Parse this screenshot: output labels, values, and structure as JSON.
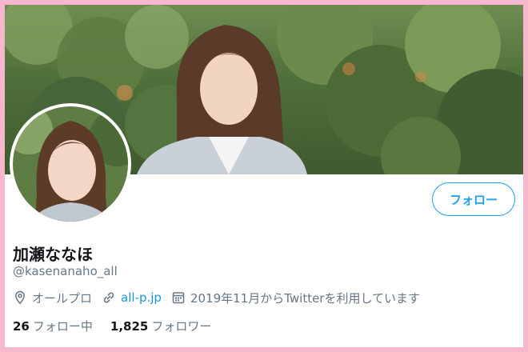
{
  "profile": {
    "display_name": "加瀬ななほ",
    "handle": "@kasenanaho_all",
    "location": "オールプロ",
    "website": "all-p.jp",
    "joined": "2019年11月からTwitterを利用しています",
    "follow_button": "フォロー"
  },
  "stats": {
    "following_count": "26",
    "following_label": "フォロー中",
    "followers_count": "1,825",
    "followers_label": "フォロワー"
  },
  "colors": {
    "accent": "#1da1f2",
    "link": "#1b95e0",
    "secondary_text": "#657786",
    "frame_border": "#f7b8cf"
  },
  "icons": {
    "location": "location-pin-icon",
    "website": "link-icon",
    "joined": "calendar-icon"
  }
}
